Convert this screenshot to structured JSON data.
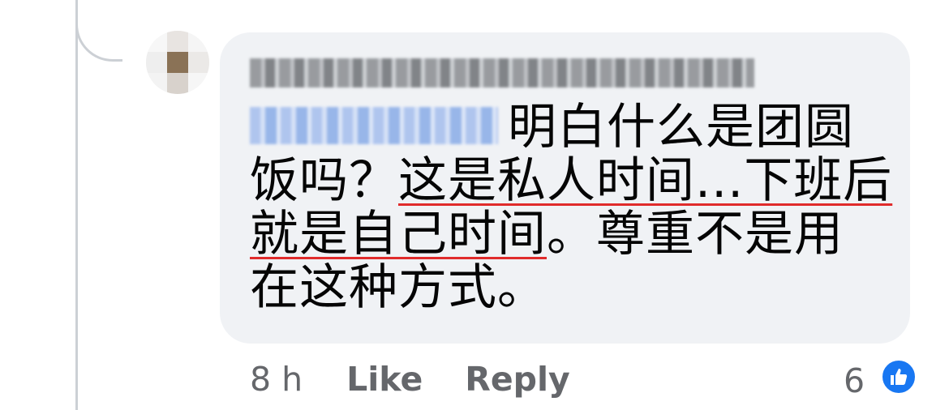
{
  "comment": {
    "author_name": "",
    "mention": "",
    "line1": "明白什么是团圆",
    "line2_plain": "饭吗？",
    "line2_underlined": "这是私人时间...下班后",
    "line3_underlined": "就是自己时间",
    "line3_plain": "。尊重不是用",
    "line4": "在这种方式。",
    "underline_color": "#e02b2b"
  },
  "meta": {
    "time": "8 h",
    "like_label": "Like",
    "reply_label": "Reply",
    "reaction_count": "6",
    "reaction_icon": "thumbs-up-icon",
    "reaction_color": "#1877f2"
  },
  "colors": {
    "bubble_bg": "#f0f2f5",
    "text": "#050505",
    "meta_text": "#65676b",
    "thread_line": "#ccd0d5"
  }
}
